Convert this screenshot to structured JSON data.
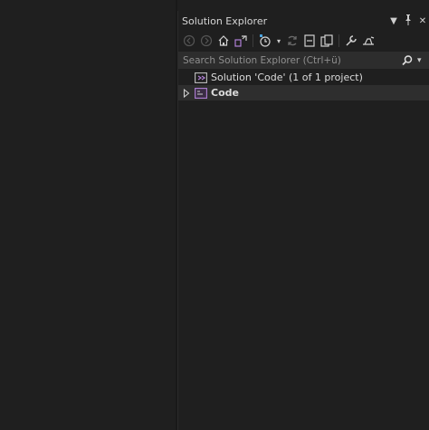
{
  "panel": {
    "title": "Solution Explorer",
    "dropdown_glyph": "▼",
    "pin_glyph": "📌",
    "close_glyph": "✕"
  },
  "toolbar": {
    "icons": [
      "back-icon",
      "forward-icon",
      "home-icon",
      "switch-views-icon",
      "pending-changes-filter-icon",
      "sync-icon",
      "collapse-all-icon",
      "show-all-files-icon",
      "properties-icon",
      "preview-icon"
    ]
  },
  "search": {
    "placeholder": "Search Solution Explorer (Ctrl+ü)",
    "dropdown_glyph": "▾"
  },
  "tree": {
    "solution_label": "Solution 'Code' (1 of 1 project)",
    "project_label": "Code",
    "project_expander_glyph": "▷"
  },
  "colors": {
    "accent": "#b180d7",
    "background": "#1f1f1f",
    "search_bg": "#2d2d2d",
    "selected_row": "#2e2e2e"
  }
}
